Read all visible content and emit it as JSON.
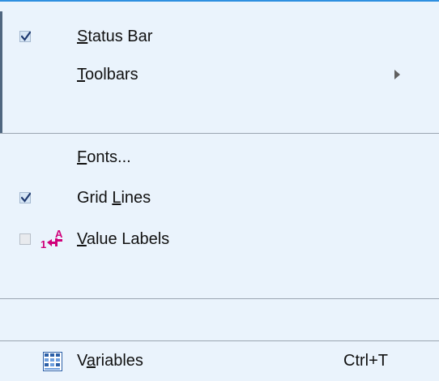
{
  "menu": {
    "items": [
      {
        "id": "status_bar",
        "label": "Status Bar",
        "mnemonic": "S",
        "checked": true
      },
      {
        "id": "toolbars",
        "label": "Toolbars",
        "mnemonic": "T",
        "submenu": true
      },
      {
        "id": "fonts",
        "label": "Fonts...",
        "mnemonic": "F"
      },
      {
        "id": "grid_lines",
        "label": "Grid Lines",
        "mnemonic": "L",
        "checked": true
      },
      {
        "id": "value_labels",
        "label": "Value Labels",
        "mnemonic": "V",
        "checked": false
      },
      {
        "id": "variables",
        "label": "Variables",
        "mnemonic": "a",
        "shortcut": "Ctrl+T"
      }
    ]
  },
  "colors": {
    "background": "#eaf3fc",
    "accent": "#2e8fe0",
    "separator": "#9aa5b1",
    "check": "#1f3a70",
    "value_icon": "#d0007a"
  },
  "icons": {
    "submenu": "chevron-right-icon",
    "value_labels": "value-labels-icon",
    "variables": "variables-icon"
  }
}
